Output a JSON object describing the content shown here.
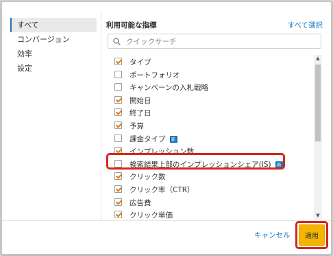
{
  "sidebar": {
    "items": [
      {
        "label": "すべて",
        "active": true
      },
      {
        "label": "コンバージョン"
      },
      {
        "label": "効率"
      },
      {
        "label": "設定"
      }
    ]
  },
  "panel": {
    "title": "利用可能な指標",
    "select_all": "すべて選択",
    "search_placeholder": "クイックサーチ"
  },
  "metrics": [
    {
      "label": "タイプ",
      "checked": true
    },
    {
      "label": "ポートフォリオ",
      "checked": false
    },
    {
      "label": "キャンペーンの入札戦略",
      "checked": false
    },
    {
      "label": "開始日",
      "checked": true
    },
    {
      "label": "終了日",
      "checked": true
    },
    {
      "label": "予算",
      "checked": true
    },
    {
      "label": "課金タイプ",
      "checked": false,
      "badge": "新"
    },
    {
      "label": "インプレッション数",
      "checked": true
    },
    {
      "label": "検索結果上部のインプレッションシェア(IS)",
      "checked": false,
      "badge": "新"
    },
    {
      "label": "クリック数",
      "checked": true
    },
    {
      "label": "クリック率（CTR）",
      "checked": true
    },
    {
      "label": "広告費",
      "checked": true
    },
    {
      "label": "クリック単価",
      "checked": true
    }
  ],
  "footer": {
    "cancel_label": "キャンセル",
    "apply_label": "適用"
  },
  "colors": {
    "accent": "#1a73b8",
    "checkmark": "#e07b00",
    "apply_button": "#f4b400",
    "highlight": "#d4261c"
  }
}
